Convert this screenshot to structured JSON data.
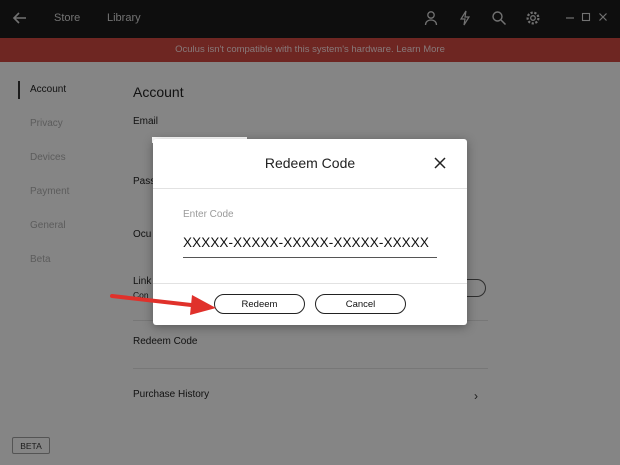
{
  "topbar": {
    "tabs": [
      "Store",
      "Library"
    ],
    "icons": [
      "back-arrow-icon",
      "user-icon",
      "lightning-icon",
      "search-icon",
      "gear-icon",
      "minimize-icon",
      "maximize-icon",
      "close-icon"
    ]
  },
  "banner": {
    "text": "Oculus isn't compatible with this system's hardware. Learn More"
  },
  "sidebar": {
    "items": [
      {
        "label": "Account",
        "active": true
      },
      {
        "label": "Privacy"
      },
      {
        "label": "Devices"
      },
      {
        "label": "Payment"
      },
      {
        "label": "General"
      },
      {
        "label": "Beta"
      }
    ],
    "beta_badge": "BETA"
  },
  "content": {
    "title": "Account",
    "email_label": "Email",
    "password_label_partial": "Pass",
    "oculus_label_partial": "Ocu",
    "linked_label_partial": "Link",
    "linked_sub_partial": "Con",
    "redeem_code": "Redeem Code",
    "purchase_history": "Purchase History"
  },
  "modal": {
    "title": "Redeem Code",
    "field_placeholder": "Enter Code",
    "code_value": "XXXXX-XXXXX-XXXXX-XXXXX-XXXXX",
    "redeem_button": "Redeem",
    "cancel_button": "Cancel"
  },
  "colors": {
    "topbar": "#1a1a1a",
    "banner": "#c8453f",
    "arrow": "#e0312b"
  }
}
